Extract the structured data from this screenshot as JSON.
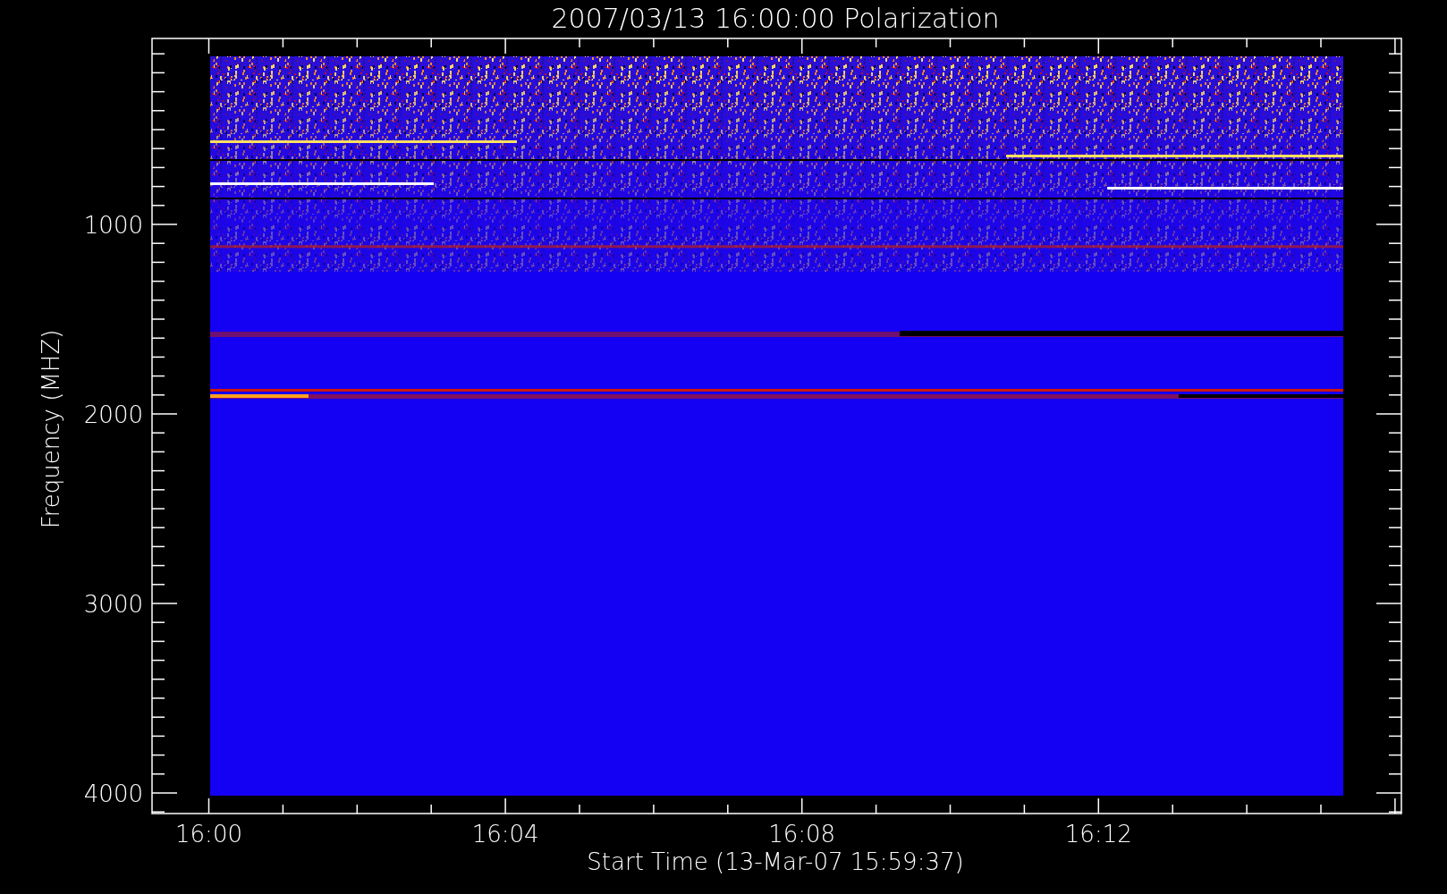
{
  "title": "2007/03/13 16:00:00 Polarization",
  "ylabel": "Frequency (MHZ)",
  "xlabel": "Start Time (13-Mar-07 15:59:37)",
  "yticks": [
    "1000",
    "2000",
    "3000",
    "4000"
  ],
  "xticks": [
    "16:00",
    "16:04",
    "16:08",
    "16:12"
  ]
}
